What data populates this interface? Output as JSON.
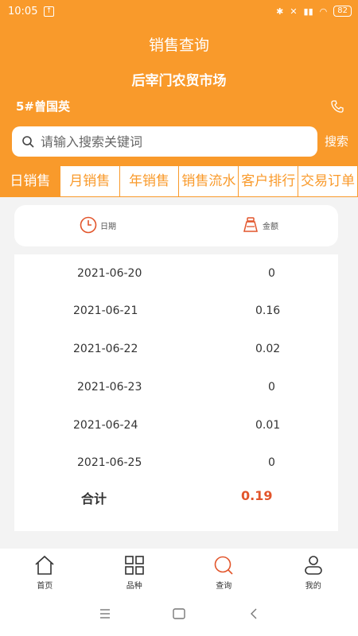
{
  "status": {
    "time": "10:05",
    "battery": "82"
  },
  "header": {
    "title": "销售查询",
    "market": "后宰门农贸市场",
    "user": "5#曾国英"
  },
  "search": {
    "placeholder": "请输入搜索关键词",
    "button": "搜索"
  },
  "tabs": [
    {
      "label": "日销售",
      "active": true
    },
    {
      "label": "月销售",
      "active": false
    },
    {
      "label": "年销售",
      "active": false
    },
    {
      "label": "销售流水",
      "active": false
    },
    {
      "label": "客户排行",
      "active": false
    },
    {
      "label": "交易订单",
      "active": false
    }
  ],
  "sort": {
    "date_label": "日期",
    "amount_label": "金额"
  },
  "rows": [
    {
      "date": "2021-06-20",
      "amount": "0"
    },
    {
      "date": "2021-06-21",
      "amount": "0.16"
    },
    {
      "date": "2021-06-22",
      "amount": "0.02"
    },
    {
      "date": "2021-06-23",
      "amount": "0"
    },
    {
      "date": "2021-06-24",
      "amount": "0.01"
    },
    {
      "date": "2021-06-25",
      "amount": "0"
    }
  ],
  "total": {
    "label": "合计",
    "value": "0.19"
  },
  "nav": [
    {
      "label": "首页",
      "icon": "home-icon"
    },
    {
      "label": "品种",
      "icon": "grid-icon"
    },
    {
      "label": "查询",
      "icon": "search-icon",
      "active": true
    },
    {
      "label": "我的",
      "icon": "user-icon"
    }
  ],
  "colors": {
    "primary": "#f99a2b",
    "total": "#e2552b"
  }
}
